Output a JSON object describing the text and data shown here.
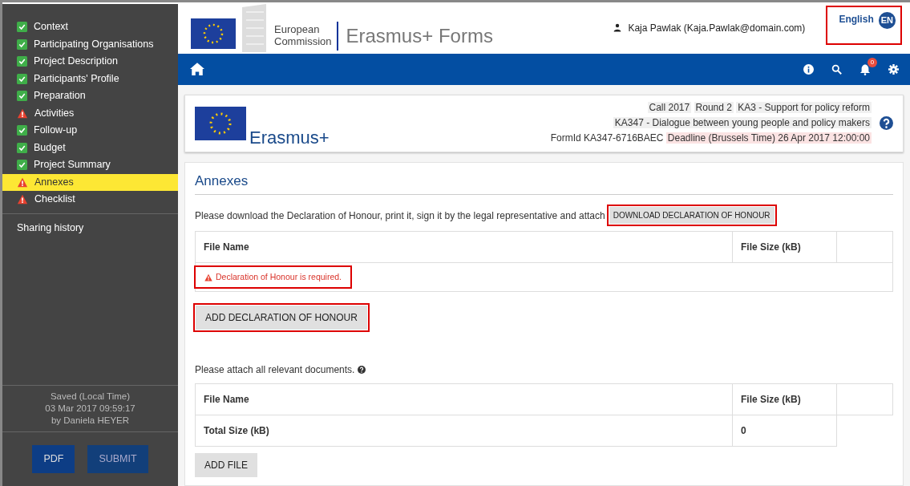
{
  "sidebar": {
    "items": [
      {
        "label": "Context",
        "kind": "done",
        "selected": false
      },
      {
        "label": "Participating Organisations",
        "kind": "done",
        "selected": false
      },
      {
        "label": "Project Description",
        "kind": "done",
        "selected": false
      },
      {
        "label": "Participants' Profile",
        "kind": "done",
        "selected": false
      },
      {
        "label": "Preparation",
        "kind": "done",
        "selected": false
      },
      {
        "label": "Activities",
        "kind": "warning",
        "selected": false
      },
      {
        "label": "Follow-up",
        "kind": "done",
        "selected": false
      },
      {
        "label": "Budget",
        "kind": "done",
        "selected": false
      },
      {
        "label": "Project Summary",
        "kind": "done",
        "selected": false
      },
      {
        "label": "Annexes",
        "kind": "warning",
        "selected": true
      },
      {
        "label": "Checklist",
        "kind": "warning",
        "selected": false
      }
    ],
    "sharing_history": "Sharing history",
    "saved": [
      "Saved (Local Time)",
      "03 Mar 2017 09:59:17",
      "by Daniela HEYER"
    ],
    "buttons": [
      "PDF",
      "SUBMIT"
    ]
  },
  "header": {
    "logo_line1": "European",
    "logo_line2": "Commission",
    "app_title": "Erasmus+ Forms",
    "user": "Kaja Pawlak (Kaja.Pawlak@domain.com)",
    "language": "English",
    "language_code": "EN",
    "language_highlighted": true
  },
  "navbar": {
    "notifications": "0"
  },
  "form_header": {
    "brand": "Erasmus+",
    "call": [
      "Call 2017",
      "Round 2",
      "KA3 - Support for policy reform"
    ],
    "action": "KA347 - Dialogue between young people and policy makers",
    "form_id": "FormId KA347-6716BAEC",
    "deadline": "Deadline (Brussels Time) 26 Apr 2017 12:00:00"
  },
  "annexes": {
    "title": "Annexes",
    "declaration": {
      "instruction": "Please download the Declaration of Honour, print it, sign it by the legal representative and attach",
      "download_button": {
        "label": "DOWNLOAD DECLARATION OF HONOUR",
        "highlighted": true
      },
      "columns": [
        "File Name",
        "File Size (kB)"
      ],
      "error": {
        "text": "Declaration of Honour is required.",
        "highlighted": true
      },
      "add_button": {
        "label": "ADD DECLARATION OF HONOUR",
        "highlighted": true
      }
    },
    "documents": {
      "instruction": "Please attach all relevant documents.",
      "columns": [
        "File Name",
        "File Size (kB)"
      ],
      "total_label": "Total Size (kB)",
      "total_value": "0",
      "add_button": {
        "label": "ADD FILE",
        "highlighted": false
      }
    }
  }
}
